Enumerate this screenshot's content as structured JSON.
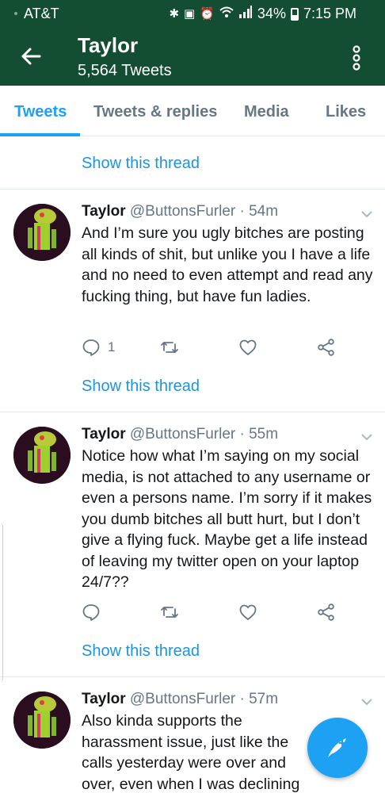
{
  "status_bar": {
    "carrier": "AT&T",
    "icons": [
      "bluetooth-icon",
      "nfc-icon",
      "alarm-icon",
      "wifi-icon",
      "signal-icon"
    ],
    "battery": "34%",
    "time": "7:15 PM"
  },
  "header": {
    "title": "Taylor",
    "subtitle": "5,564 Tweets",
    "background": "#134e32"
  },
  "tabs": [
    {
      "label": "Tweets",
      "active": true
    },
    {
      "label": "Tweets & replies",
      "active": false
    },
    {
      "label": "Media",
      "active": false
    },
    {
      "label": "Likes",
      "active": false
    }
  ],
  "top_thread_link": "Show this thread",
  "tweets": [
    {
      "name": "Taylor",
      "meta": "@ButtonsFurler · 54m",
      "text": "And I’m sure you ugly bitches are posting all kinds of shit, but unlike you I have a life and no need to even attempt and read any fucking thing, but have fun ladies.",
      "reply_count": "1",
      "thread_link": "Show this thread"
    },
    {
      "name": "Taylor",
      "meta": "@ButtonsFurler · 55m",
      "text": "Notice how what I’m saying on my social media, is not attached to any username or even a persons name. I’m sorry if it makes you dumb bitches all butt hurt, but I don’t give a flying fuck. Maybe get a life instead of leaving my twitter open on your laptop 24/7??",
      "reply_count": "",
      "thread_link": "Show this thread"
    },
    {
      "name": "Taylor",
      "meta": "@ButtonsFurler · 57m",
      "text": "Also kinda supports the harassment issue, just like the calls yesterday were over and over, even when I was declining them. Blocking a number",
      "reply_count": "",
      "thread_link": ""
    }
  ],
  "colors": {
    "accent": "#1da1f2",
    "link": "#1b95e0",
    "muted": "#657786"
  }
}
